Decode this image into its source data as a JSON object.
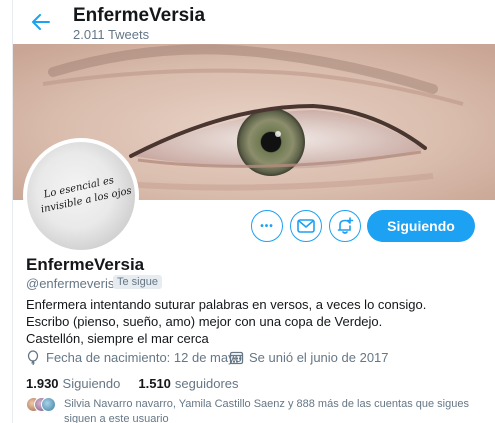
{
  "topbar": {
    "name": "EnfermeVersia",
    "tweet_count": "2.011 Tweets"
  },
  "profile": {
    "name": "EnfermeVersia",
    "handle": "@enfermeverisa",
    "follows_you_badge": "Te sigue",
    "avatar_text_line1": "Lo esencial es",
    "avatar_text_line2": "invisible a los ojos",
    "bio": [
      "Enfermera intentando suturar palabras en versos, a veces lo consigo.",
      "Escribo (pienso, sueño, amo) mejor con una copa de Verdejo.",
      "Castellón, siempre el mar cerca"
    ],
    "birthday": "Fecha de nacimiento: 12 de mayo",
    "joined": "Se unió el junio de 2017"
  },
  "actions": {
    "more_label": "•••",
    "follow_label": "Siguiendo"
  },
  "stats": {
    "following_count": "1.930",
    "following_label": "Siguiendo",
    "followers_count": "1.510",
    "followers_label": "seguidores"
  },
  "known_followers": {
    "text": "Silvia Navarro navarro, Yamila Castillo Saenz y 888 más de las cuentas que sigues siguen a este usuario"
  },
  "colors": {
    "accent": "#1da1f2",
    "secondary_text": "#657786"
  }
}
